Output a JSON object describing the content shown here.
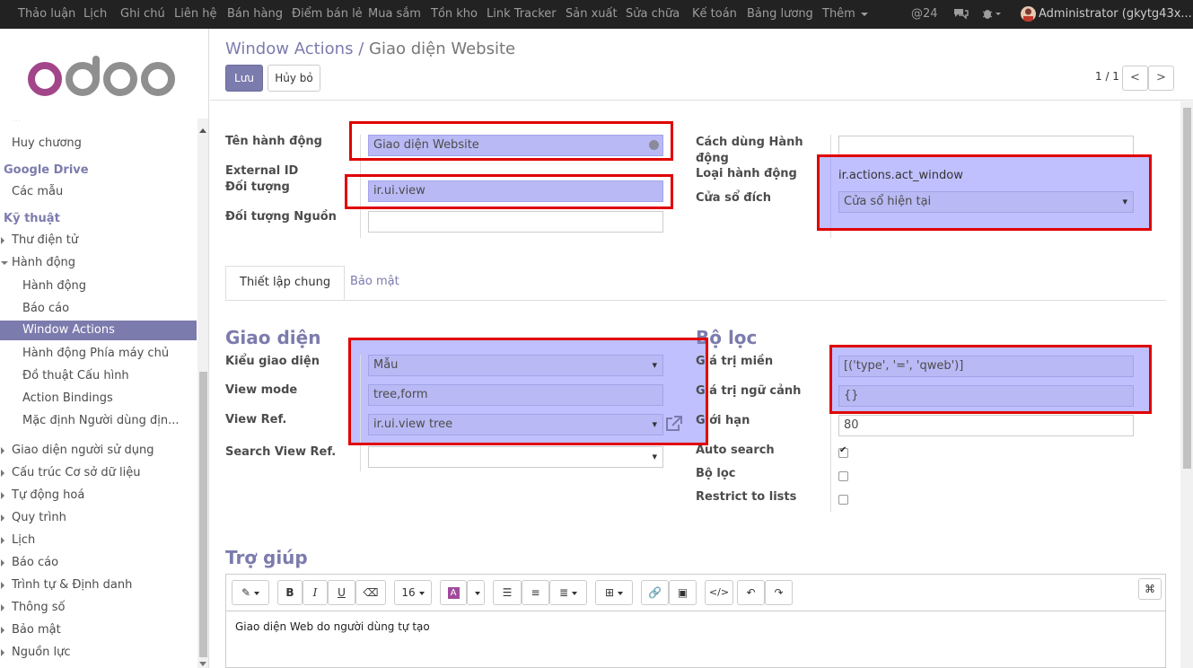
{
  "topbar": {
    "menus": [
      "Thảo luận",
      "Lịch",
      "Ghi chú",
      "Liên hệ",
      "Bán hàng",
      "Điểm bán lẻ",
      "Mua sắm",
      "Tồn kho",
      "Link Tracker",
      "Sản xuất",
      "Sửa chữa",
      "Kế toán",
      "Bảng lương",
      "Thêm"
    ],
    "mentions": "@24",
    "user": "Administrator (gkytg43x..."
  },
  "sidebar": {
    "logo": "odoo",
    "items": [
      {
        "label": "Huy chương",
        "kind": "l1"
      },
      {
        "label": "Google Drive",
        "kind": "hdr"
      },
      {
        "label": "Các mẫu",
        "kind": "l1"
      },
      {
        "label": "Kỹ thuật",
        "kind": "hdr"
      },
      {
        "label": "Thư điện tử",
        "kind": "l1"
      },
      {
        "label": "Hành động",
        "kind": "l1"
      },
      {
        "label": "Hành động",
        "kind": "l2"
      },
      {
        "label": "Báo cáo",
        "kind": "l2"
      },
      {
        "label": "Window Actions",
        "kind": "active"
      },
      {
        "label": "Hành động Phía máy chủ",
        "kind": "l2"
      },
      {
        "label": "Đồ thuật Cấu hình",
        "kind": "l2"
      },
      {
        "label": "Action Bindings",
        "kind": "l2"
      },
      {
        "label": "Mặc định Người dùng địn...",
        "kind": "l2"
      },
      {
        "label": "Giao diện người sử dụng",
        "kind": "l1"
      },
      {
        "label": "Cấu trúc Cơ sở dữ liệu",
        "kind": "l1"
      },
      {
        "label": "Tự động hoá",
        "kind": "l1"
      },
      {
        "label": "Quy trình",
        "kind": "l1"
      },
      {
        "label": "Lịch",
        "kind": "l1"
      },
      {
        "label": "Báo cáo",
        "kind": "l1"
      },
      {
        "label": "Trình tự & Định danh",
        "kind": "l1"
      },
      {
        "label": "Thông số",
        "kind": "l1"
      },
      {
        "label": "Bảo mật",
        "kind": "l1"
      },
      {
        "label": "Nguồn lực",
        "kind": "l1"
      }
    ]
  },
  "controlpanel": {
    "breadcrumb_parent": "Window Actions",
    "breadcrumb_sep": "/",
    "breadcrumb_current": "Giao diện Website",
    "save_label": "Lưu",
    "discard_label": "Hủy bỏ",
    "pager": "1 / 1",
    "pager_prev": "<",
    "pager_next": ">"
  },
  "form": {
    "action_name_label": "Tên hành động",
    "action_name_value": "Giao diện Website",
    "external_id_label": "External ID",
    "object_label": "Đối tượng",
    "object_value": "ir.ui.view",
    "source_object_label": "Đối tượng Nguồn",
    "source_object_value": "",
    "action_usage_label": "Cách dùng Hành động",
    "action_usage_value": "",
    "action_type_label": "Loại hành động",
    "action_type_value": "ir.actions.act_window",
    "target_label": "Cửa sổ đích",
    "target_value": "Cửa sổ hiện tại",
    "tabs": [
      "Thiết lập chung",
      "Bảo mật"
    ],
    "views_header": "Giao diện",
    "view_type_label": "Kiểu giao diện",
    "view_type_value": "Mẫu",
    "view_mode_label": "View mode",
    "view_mode_value": "tree,form",
    "view_ref_label": "View Ref.",
    "view_ref_value": "ir.ui.view tree",
    "search_view_label": "Search View Ref.",
    "search_view_value": "",
    "filters_header": "Bộ lọc",
    "domain_label": "Giá trị miền",
    "domain_value": "[('type', '=', 'qweb')]",
    "context_label": "Giá trị ngữ cảnh",
    "context_value": "{}",
    "limit_label": "Giới hạn",
    "limit_value": "80",
    "auto_search_label": "Auto search",
    "auto_search": true,
    "filter_label": "Bộ lọc",
    "filter": false,
    "restrict_label": "Restrict to lists",
    "restrict": false,
    "help_header": "Trợ giúp",
    "font_size": "16",
    "help_text": "Giao diện Web do người dùng tự tạo"
  },
  "colors": {
    "brand": "#7c7bad",
    "highlight": "#8c8cff",
    "annotation": "#e00000"
  }
}
